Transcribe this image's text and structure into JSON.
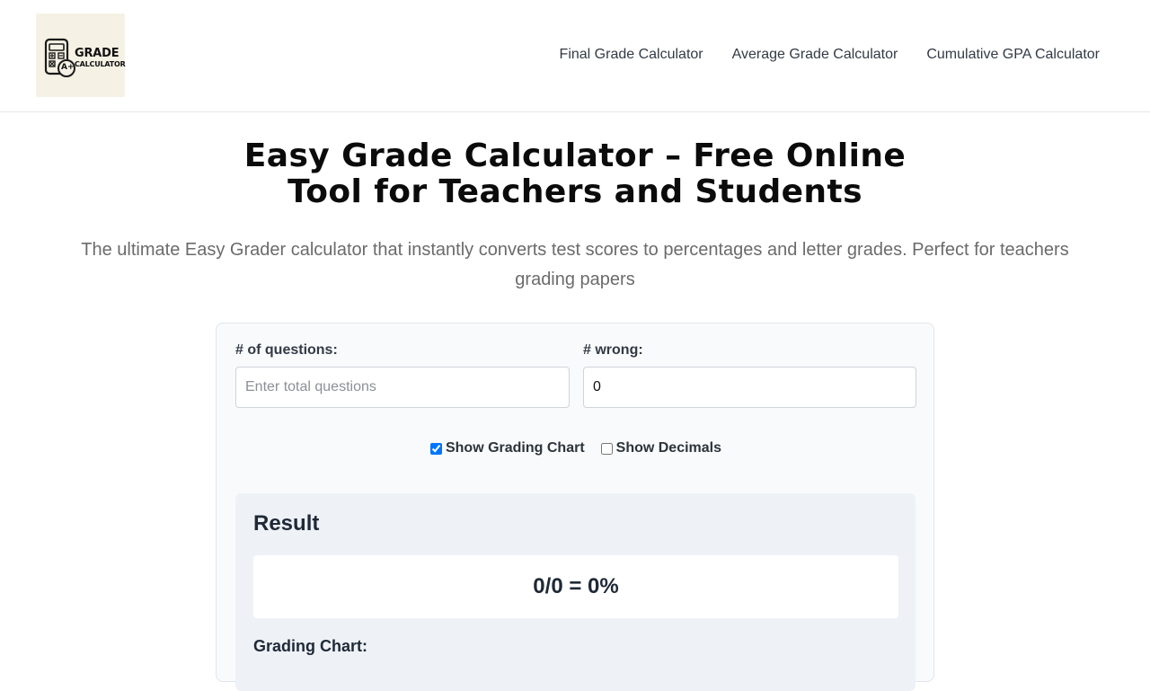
{
  "header": {
    "logo": {
      "line1": "GRADE",
      "line2": "CALCULATOR",
      "badge": "A+"
    },
    "nav": [
      {
        "label": "Final Grade Calculator"
      },
      {
        "label": "Average Grade Calculator"
      },
      {
        "label": "Cumulative GPA Calculator"
      }
    ]
  },
  "hero": {
    "title_line1": "Easy Grade Calculator – Free Online",
    "title_line2": "Tool for Teachers and Students",
    "subtitle": "The ultimate Easy Grader calculator that instantly converts test scores to percentages and letter grades. Perfect for teachers grading papers"
  },
  "calculator": {
    "questions": {
      "label": "# of questions:",
      "placeholder": "Enter total questions",
      "value": ""
    },
    "wrong": {
      "label": "# wrong:",
      "value": "0"
    },
    "options": {
      "show_chart": {
        "label": "Show Grading Chart",
        "checked": true
      },
      "show_decimals": {
        "label": "Show Decimals",
        "checked": false
      }
    },
    "result": {
      "heading": "Result",
      "value": "0/0 = 0%",
      "chart_heading": "Grading Chart:"
    }
  },
  "colors": {
    "card_bg": "#f8fafc",
    "result_bg": "#eef2f7",
    "nav_text": "#333a45",
    "subtitle_text": "#6b6b6b"
  }
}
